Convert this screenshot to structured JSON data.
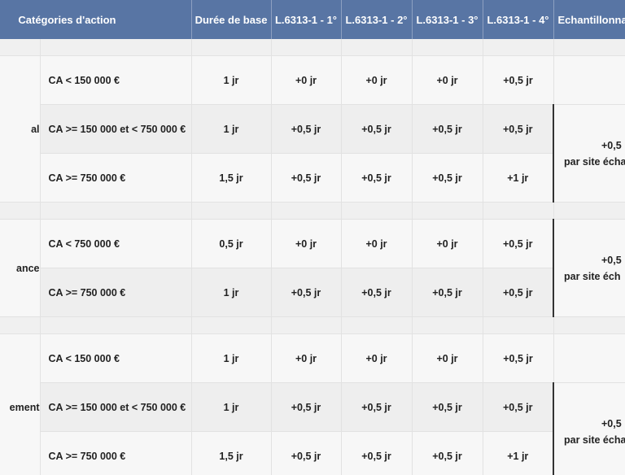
{
  "header": {
    "categories": "Catégories d'action",
    "base": "Durée de base",
    "l1": "L.6313-1 - 1°",
    "l2": "L.6313-1 - 2°",
    "l3": "L.6313-1 - 3°",
    "l4": "L.6313-1 - 4°",
    "sampling": "Echantillonna"
  },
  "groups": [
    {
      "label": "al",
      "rows": [
        {
          "range": "CA < 150 000 €",
          "base": "1 jr",
          "v1": "+0 jr",
          "v2": "+0 jr",
          "v3": "+0 jr",
          "v4": "+0,5 jr"
        },
        {
          "range": "CA >= 150 000 et < 750 000 €",
          "base": "1 jr",
          "v1": "+0,5 jr",
          "v2": "+0,5 jr",
          "v3": "+0,5 jr",
          "v4": "+0,5 jr"
        },
        {
          "range": "CA >= 750 000 €",
          "base": "1,5 jr",
          "v1": "+0,5 jr",
          "v2": "+0,5 jr",
          "v3": "+0,5 jr",
          "v4": "+1 jr"
        }
      ],
      "sampling_l1": "+0,5",
      "sampling_l2": "par site écha"
    },
    {
      "label": "ance",
      "rows": [
        {
          "range": "CA < 750 000 €",
          "base": "0,5 jr",
          "v1": "+0 jr",
          "v2": "+0 jr",
          "v3": "+0 jr",
          "v4": "+0,5 jr"
        },
        {
          "range": "CA >= 750 000 €",
          "base": "1 jr",
          "v1": "+0,5 jr",
          "v2": "+0,5 jr",
          "v3": "+0,5 jr",
          "v4": "+0,5 jr"
        }
      ],
      "sampling_l1": "+0,5",
      "sampling_l2": "par site éch"
    },
    {
      "label": "ement",
      "rows": [
        {
          "range": "CA < 150 000 €",
          "base": "1 jr",
          "v1": "+0 jr",
          "v2": "+0 jr",
          "v3": "+0 jr",
          "v4": "+0,5 jr"
        },
        {
          "range": "CA >= 150 000 et < 750 000 €",
          "base": "1 jr",
          "v1": "+0,5 jr",
          "v2": "+0,5 jr",
          "v3": "+0,5 jr",
          "v4": "+0,5 jr"
        },
        {
          "range": "CA >= 750 000 €",
          "base": "1,5 jr",
          "v1": "+0,5 jr",
          "v2": "+0,5 jr",
          "v3": "+0,5 jr",
          "v4": "+1 jr"
        }
      ],
      "sampling_l1": "+0,5",
      "sampling_l2": "par site écha"
    }
  ]
}
